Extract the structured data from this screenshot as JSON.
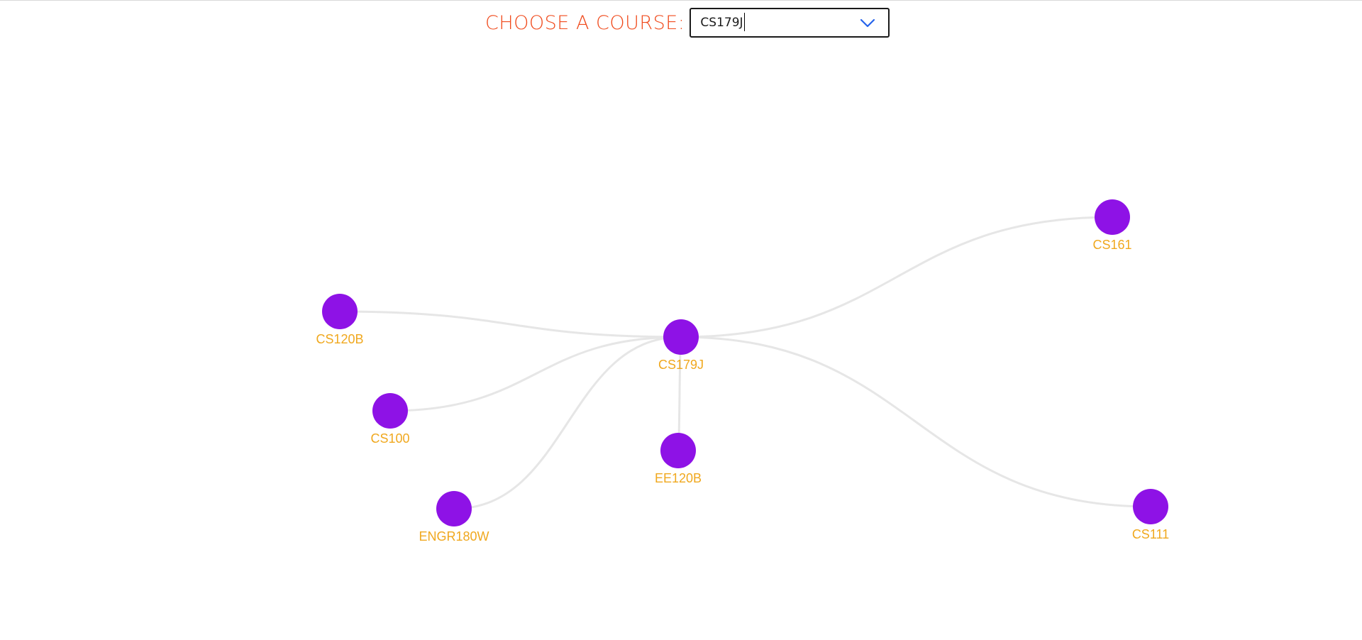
{
  "header": {
    "label": "CHOOSE A COURSE:",
    "selected_value": "CS179J"
  },
  "icons": {
    "dropdown": "chevron-down-icon"
  },
  "colors": {
    "label": "#f04a1c",
    "node_fill": "#8e12e6",
    "node_label": "#f0a81e",
    "edge": "#e6e6e6",
    "chevron": "#2563eb"
  },
  "graph": {
    "center": "CS179J",
    "nodes": [
      {
        "id": "CS179J",
        "label": "CS179J"
      },
      {
        "id": "CS161",
        "label": "CS161"
      },
      {
        "id": "CS120B",
        "label": "CS120B"
      },
      {
        "id": "CS100",
        "label": "CS100"
      },
      {
        "id": "ENGR180W",
        "label": "ENGR180W"
      },
      {
        "id": "EE120B",
        "label": "EE120B"
      },
      {
        "id": "CS111",
        "label": "CS111"
      }
    ],
    "edges": [
      {
        "source": "CS179J",
        "target": "CS161"
      },
      {
        "source": "CS179J",
        "target": "CS120B"
      },
      {
        "source": "CS179J",
        "target": "CS100"
      },
      {
        "source": "CS179J",
        "target": "ENGR180W"
      },
      {
        "source": "CS179J",
        "target": "EE120B"
      },
      {
        "source": "CS179J",
        "target": "CS111"
      }
    ]
  }
}
